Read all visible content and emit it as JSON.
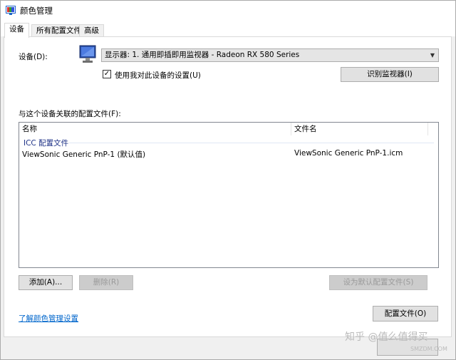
{
  "window": {
    "title": "颜色管理"
  },
  "tabs": [
    {
      "label": "设备",
      "active": true
    },
    {
      "label": "所有配置文件",
      "active": false
    },
    {
      "label": "高级",
      "active": false
    }
  ],
  "device": {
    "label": "设备(D):",
    "selected": "显示器: 1. 通用即插即用监视器 - Radeon RX 580 Series",
    "use_settings_label": "使用我对此设备的设置(U)",
    "use_settings_checked": true,
    "identify_button": "识别监视器(I)"
  },
  "profiles": {
    "label": "与这个设备关联的配置文件(F):",
    "columns": [
      "名称",
      "文件名"
    ],
    "group": "ICC 配置文件",
    "rows": [
      {
        "name": "ViewSonic Generic PnP-1 (默认值)",
        "file": "ViewSonic Generic PnP-1.icm"
      }
    ]
  },
  "buttons": {
    "add": "添加(A)...",
    "remove": "删除(R)",
    "set_default": "设为默认配置文件(S)",
    "profiles": "配置文件(O)"
  },
  "footer": {
    "link": "了解颜色管理设置"
  },
  "watermark": {
    "text": "知乎 @值么值得买",
    "url": "SMZDM.COM"
  },
  "colors": {
    "accent_link": "#0066cc",
    "group_title": "#1e3287"
  }
}
